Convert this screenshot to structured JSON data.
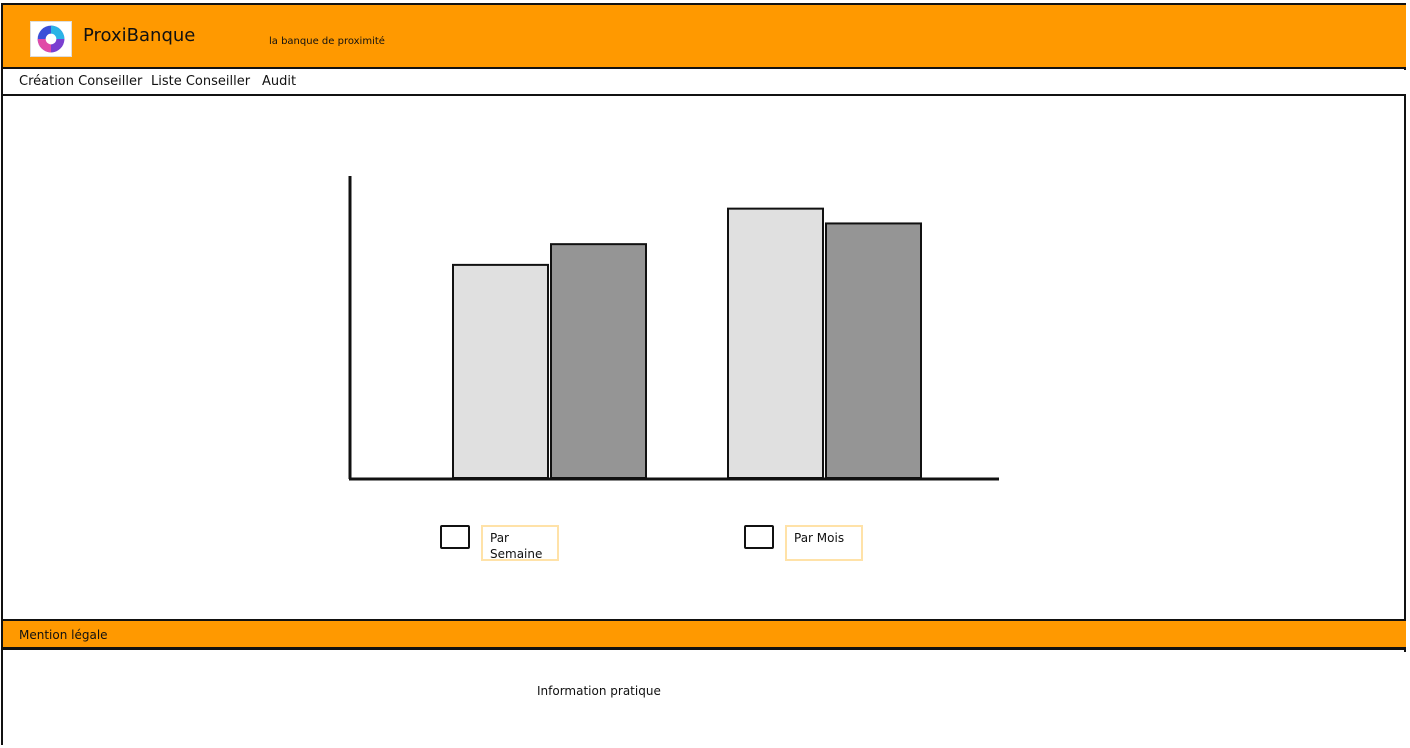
{
  "header": {
    "brand": "ProxiBanque",
    "tagline": "la banque de proximité",
    "logo_icon": "swirl-logo-icon",
    "bg_color": "#ff9900"
  },
  "nav": {
    "items": [
      {
        "label": "Création Conseiller"
      },
      {
        "label": "Liste Conseiller"
      },
      {
        "label": "Audit"
      }
    ]
  },
  "chart_data": {
    "type": "bar",
    "categories": [
      "",
      ""
    ],
    "series": [
      {
        "values": [
          72,
          91
        ],
        "color": "#e0e0e0"
      },
      {
        "values": [
          79,
          86
        ],
        "color": "#959595"
      }
    ],
    "ylim": [
      0,
      100
    ],
    "title": "",
    "xlabel": "",
    "ylabel": "",
    "grid": false
  },
  "options": [
    {
      "label": "Par Semaine",
      "checked": false
    },
    {
      "label": "Par Mois",
      "checked": false
    }
  ],
  "legal": {
    "label": "Mention légale"
  },
  "footer": {
    "text": "Information pratique"
  }
}
